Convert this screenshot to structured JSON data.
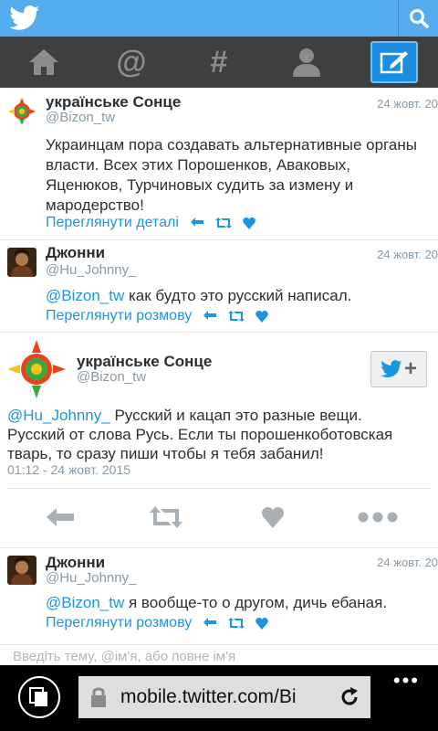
{
  "topbar": {
    "logo_icon": "twitter-bird-icon",
    "search_icon": "search-icon"
  },
  "nav": {
    "items": [
      {
        "name": "home-icon"
      },
      {
        "name": "mentions-icon",
        "glyph": "@"
      },
      {
        "name": "hashtag-icon",
        "glyph": "#"
      },
      {
        "name": "profile-icon"
      },
      {
        "name": "compose-icon"
      }
    ]
  },
  "tweets": [
    {
      "name": "українське Сонце",
      "handle": "@Bizon_tw",
      "date": "24 жовт. 20",
      "text_lines": [
        "Украинцам пора создавать альтернативные органы",
        "власти. Всех этих Порошенков, Аваковых,",
        "Яценюков, Турчиновых судить за измену и",
        "мародерство!"
      ],
      "action_link": "Переглянути деталі"
    },
    {
      "name": "Джонни",
      "handle": "@Hu_Johnny_",
      "date": "24 жовт. 20",
      "mention": "@Bizon_tw",
      "text": " как будто это русский написал.",
      "action_link": "Переглянути розмову"
    },
    {
      "name": "Джонни",
      "handle": "@Hu_Johnny_",
      "date": "24 жовт. 20",
      "mention": "@Bizon_tw",
      "text": " я вообще-то о другом, дичь ебаная.",
      "action_link": "Переглянути розмову"
    }
  ],
  "expanded": {
    "name": "українське Сонце",
    "handle": "@Bizon_tw",
    "mention": "@Hu_Johnny_",
    "text_line1": " Русский и кацап это разные вещи.",
    "text_line2": "Русский от слова Русь. Если ты порошенкоботовская",
    "text_line3": "тварь, то сразу пиши чтобы я тебя забанил!",
    "timestamp": "01:12 - 24 жовт. 2015",
    "follow_plus": "+"
  },
  "compose_hint": "Введіть тему, @ім'я, або повне ім'я",
  "browser": {
    "url": "mobile.twitter.com/Bi",
    "more": "•••"
  },
  "colors": {
    "topbar": "#55acee",
    "navbar": "#3d3f41",
    "link": "#1b95e0",
    "muted": "#8899a6"
  }
}
